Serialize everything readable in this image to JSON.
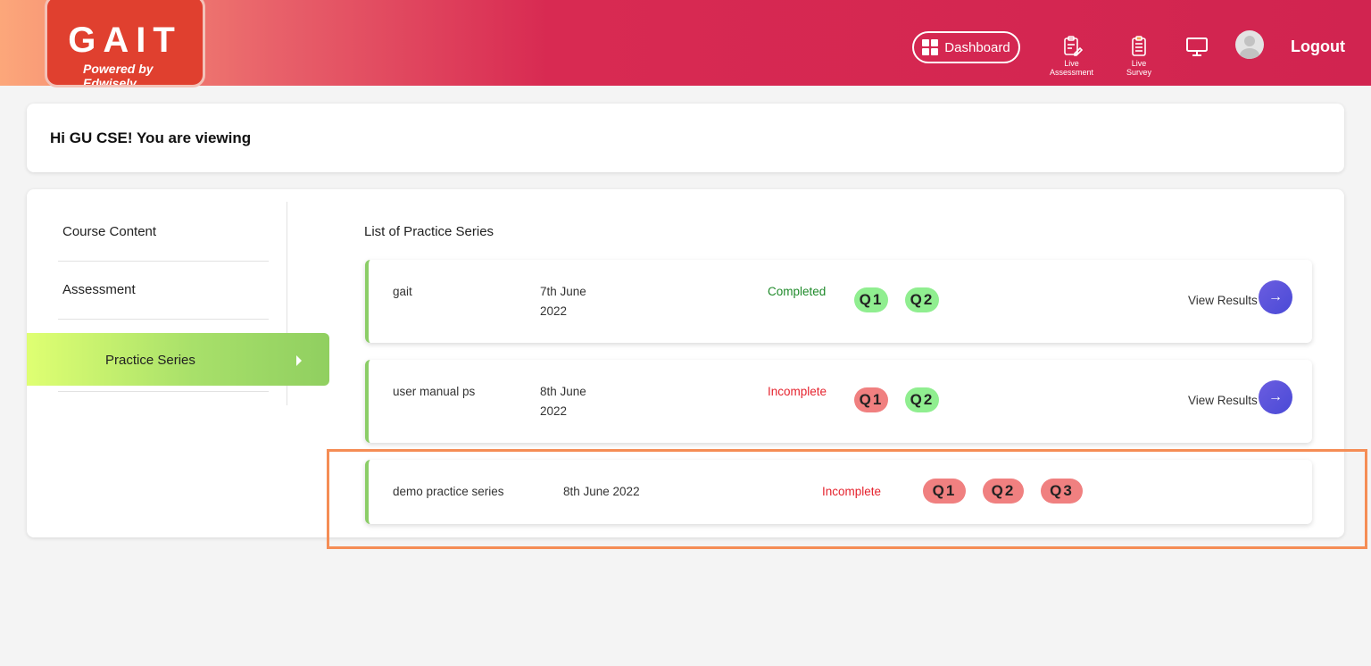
{
  "header": {
    "logo_text": "GAIT",
    "logo_subtext": "Powered by Edwisely",
    "dashboard_label": "Dashboard",
    "live_assessment_label_1": "Live",
    "live_assessment_label_2": "Assessment",
    "live_survey_label_1": "Live",
    "live_survey_label_2": "Survey",
    "logout_label": "Logout"
  },
  "greeting": "Hi GU CSE! You are viewing",
  "sidebar": {
    "items": [
      {
        "label": "Course Content"
      },
      {
        "label": "Assessment"
      },
      {
        "label": "Practice Series"
      }
    ],
    "active": "Practice Series"
  },
  "main": {
    "list_title": "List of Practice Series",
    "rows": [
      {
        "name": "gait",
        "date_line1": "7th June",
        "date_line2": "2022",
        "status": "Completed",
        "questions": [
          {
            "label": "Q1",
            "state": "correct"
          },
          {
            "label": "Q2",
            "state": "correct"
          }
        ],
        "action": "View Results"
      },
      {
        "name": "user manual ps",
        "date_line1": "8th June",
        "date_line2": "2022",
        "status": "Incomplete",
        "questions": [
          {
            "label": "Q1",
            "state": "incorrect"
          },
          {
            "label": "Q2",
            "state": "correct"
          }
        ],
        "action": "View Results"
      },
      {
        "name": "demo practice series",
        "date": "8th June 2022",
        "status": "Incomplete",
        "questions": [
          {
            "label": "Q1",
            "state": "incorrect"
          },
          {
            "label": "Q2",
            "state": "incorrect"
          },
          {
            "label": "Q3",
            "state": "incorrect"
          }
        ]
      }
    ]
  },
  "colors": {
    "header_gradient_start": "#fca77a",
    "header_gradient_end": "#d12450",
    "correct": "#90ee90",
    "incorrect": "#f08080",
    "completed_text": "#1f8a2a",
    "incomplete_text": "#e5232e",
    "highlight_border": "#f58d55",
    "action_button": "#5b50dc"
  }
}
